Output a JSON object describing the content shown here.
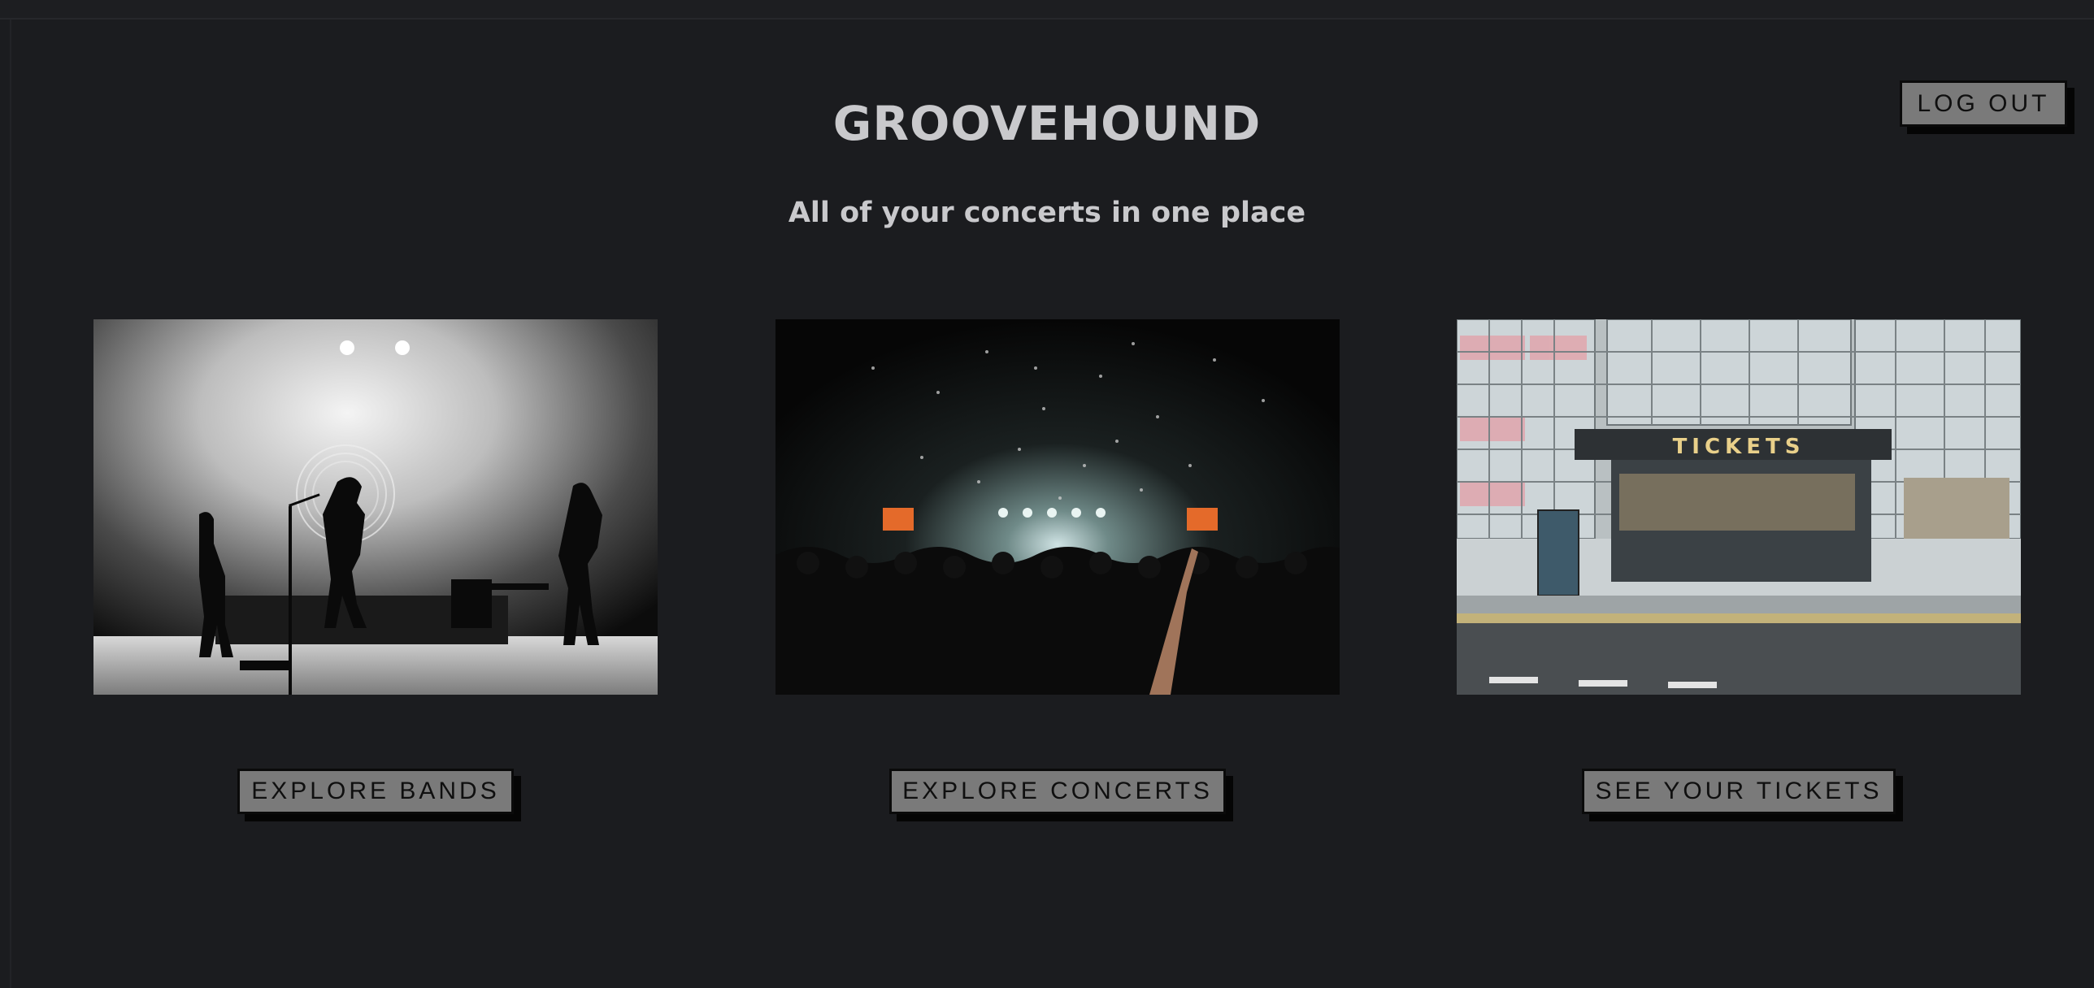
{
  "header": {
    "title": "GROOVEHOUND",
    "subtitle": "All of your concerts in one place",
    "logout_label": "LOG OUT"
  },
  "cards": [
    {
      "image": "band-on-stage-photo",
      "button_label": "EXPLORE BANDS"
    },
    {
      "image": "concert-crowd-confetti-photo",
      "button_label": "EXPLORE CONCERTS"
    },
    {
      "image": "ticket-booth-photo",
      "button_label": "SEE YOUR TICKETS",
      "sign_text": "TICKETS"
    }
  ],
  "colors": {
    "background": "#1b1c1f",
    "text": "#c9c9cc",
    "button_fill": "#7a7a7a",
    "button_shadow": "#050505"
  }
}
